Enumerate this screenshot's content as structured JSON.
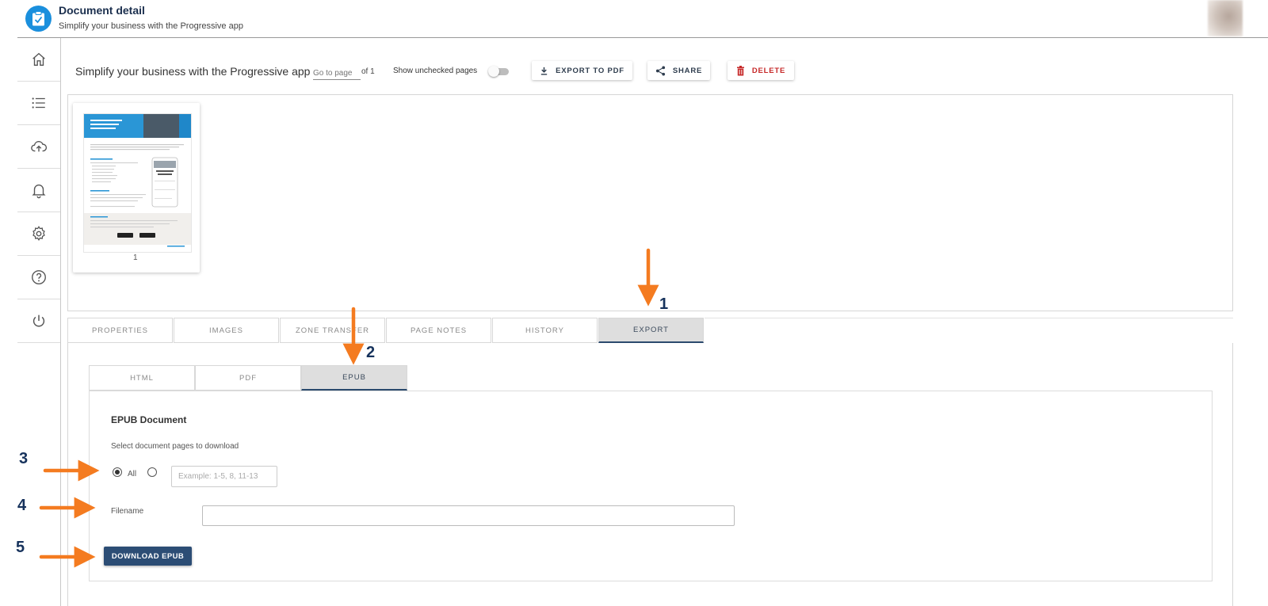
{
  "header": {
    "title": "Document detail",
    "subtitle": "Simplify your business with the Progressive app"
  },
  "sidebar": {
    "items": [
      {
        "icon": "home-icon"
      },
      {
        "icon": "list-icon"
      },
      {
        "icon": "cloud-upload-icon"
      },
      {
        "icon": "bell-icon"
      },
      {
        "icon": "gear-icon"
      },
      {
        "icon": "help-icon"
      },
      {
        "icon": "power-icon"
      }
    ]
  },
  "toolbar": {
    "document_title": "Simplify your business with the Progressive app",
    "goto_placeholder": "Go to page",
    "page_of": "of 1",
    "show_unchecked_label": "Show unchecked pages",
    "show_unchecked_on": false,
    "export_pdf_label": "EXPORT TO PDF",
    "share_label": "SHARE",
    "delete_label": "DELETE"
  },
  "preview": {
    "page_number": "1"
  },
  "main_tabs": {
    "active": "EXPORT",
    "items": [
      "PROPERTIES",
      "IMAGES",
      "ZONE TRANSFER",
      "PAGE NOTES",
      "HISTORY",
      "EXPORT"
    ]
  },
  "export_tabs": {
    "active": "EPUB",
    "items": [
      "HTML",
      "PDF",
      "EPUB"
    ]
  },
  "epub": {
    "heading": "EPUB Document",
    "select_pages_label": "Select document pages to download",
    "radio_all_label": "All",
    "range_placeholder": "Example: 1-5, 8, 11-13",
    "filename_label": "Filename",
    "filename_value": "",
    "download_label": "DOWNLOAD EPUB"
  },
  "annotations": {
    "labels": [
      "1",
      "2",
      "3",
      "4",
      "5"
    ],
    "arrow_color": "#f47b20",
    "number_color": "#16325c"
  },
  "colors": {
    "accent": "#2c4d75",
    "logo": "#1a8fdd",
    "delete": "#c62828"
  }
}
